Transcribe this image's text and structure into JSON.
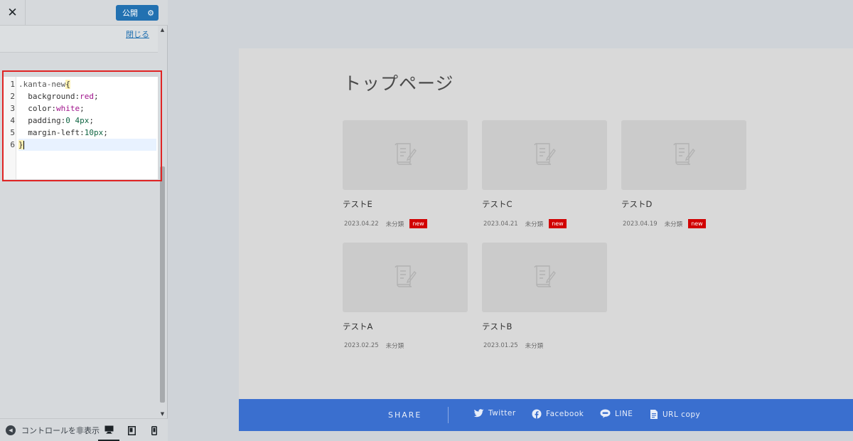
{
  "topbar": {
    "close_glyph": "✕",
    "publish_label": "公開",
    "settings_icon": "gear-icon"
  },
  "section": {
    "close_link": "閉じる"
  },
  "editor": {
    "line_numbers": [
      "1",
      "2",
      "3",
      "4",
      "5",
      "6"
    ],
    "lines": [
      [
        {
          "t": "sel",
          "v": ".kanta-new"
        },
        {
          "t": "br",
          "v": "{"
        }
      ],
      [
        {
          "t": "prop",
          "v": "  background:"
        },
        {
          "t": "val",
          "v": "red"
        },
        {
          "t": "prop",
          "v": ";"
        }
      ],
      [
        {
          "t": "prop",
          "v": "  color:"
        },
        {
          "t": "val",
          "v": "white"
        },
        {
          "t": "prop",
          "v": ";"
        }
      ],
      [
        {
          "t": "prop",
          "v": "  padding:"
        },
        {
          "t": "num",
          "v": "0 4px"
        },
        {
          "t": "prop",
          "v": ";"
        }
      ],
      [
        {
          "t": "prop",
          "v": "  margin-left:"
        },
        {
          "t": "num",
          "v": "10px"
        },
        {
          "t": "prop",
          "v": ";"
        }
      ],
      [
        {
          "t": "br",
          "v": "}"
        }
      ]
    ],
    "active_line": 6
  },
  "footer": {
    "hide_controls_label": "コントロールを非表示",
    "devices": [
      "desktop",
      "tablet",
      "mobile"
    ],
    "active_device": "desktop"
  },
  "preview": {
    "page_title": "トップページ",
    "posts": [
      {
        "title": "テストE",
        "date": "2023.04.22",
        "category": "未分類",
        "badge": "new"
      },
      {
        "title": "テストC",
        "date": "2023.04.21",
        "category": "未分類",
        "badge": "new"
      },
      {
        "title": "テストD",
        "date": "2023.04.19",
        "category": "未分類",
        "badge": "new"
      },
      {
        "title": "テストA",
        "date": "2023.02.25",
        "category": "未分類",
        "badge": ""
      },
      {
        "title": "テストB",
        "date": "2023.01.25",
        "category": "未分類",
        "badge": ""
      }
    ]
  },
  "share": {
    "label": "SHARE",
    "links": [
      {
        "label": "Twitter",
        "icon": "twitter-icon"
      },
      {
        "label": "Facebook",
        "icon": "facebook-icon"
      },
      {
        "label": "LINE",
        "icon": "line-icon"
      },
      {
        "label": "URL copy",
        "icon": "copy-icon"
      }
    ]
  },
  "colors": {
    "publish_button": "#2271b1",
    "highlight_border": "#e02424",
    "badge": "#d10000",
    "share_bar": "#3a6fcf"
  }
}
